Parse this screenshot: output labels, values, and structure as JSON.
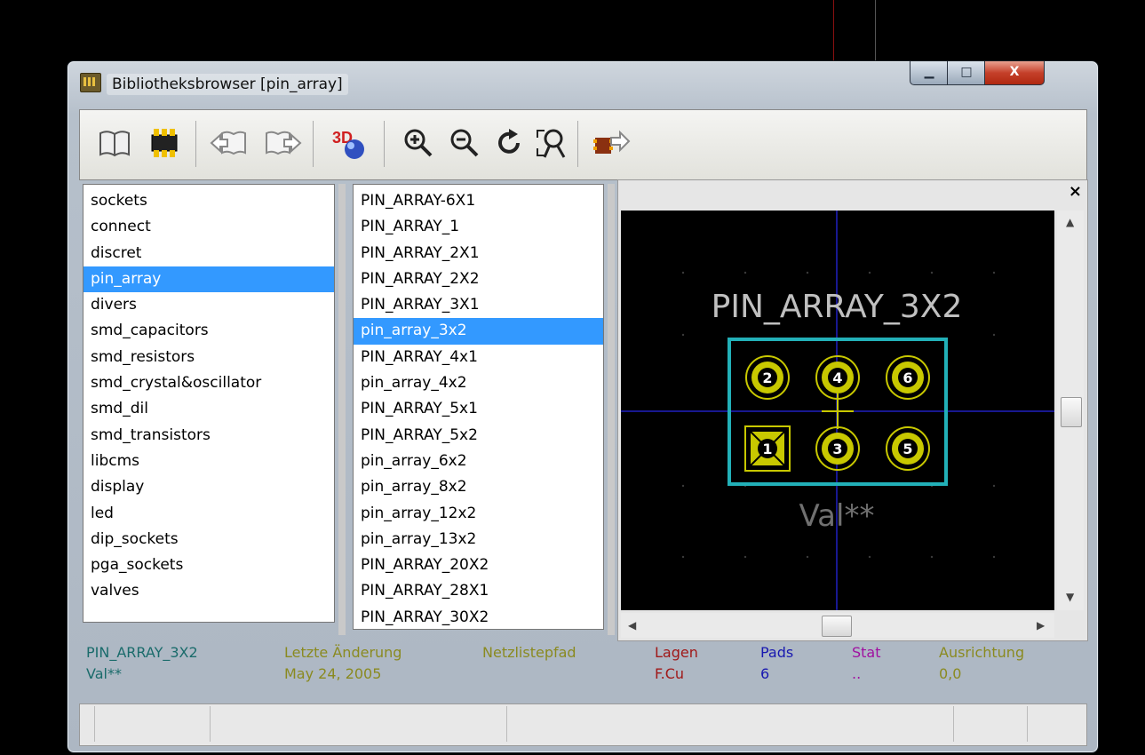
{
  "window": {
    "title": "Bibliotheksbrowser [pin_array]"
  },
  "window_controls": {
    "minimize": "▁",
    "maximize": "□",
    "close": "X"
  },
  "toolbar": [
    {
      "name": "select-library-icon",
      "glyph": "📖"
    },
    {
      "name": "select-footprint-icon",
      "glyph": "▦"
    },
    {
      "name": "previous-footprint-icon",
      "glyph": "⇦"
    },
    {
      "name": "next-footprint-icon",
      "glyph": "⇨"
    },
    {
      "name": "3d-view-icon",
      "glyph": "3D"
    },
    {
      "name": "zoom-in-icon",
      "glyph": "⊕"
    },
    {
      "name": "zoom-out-icon",
      "glyph": "⊖"
    },
    {
      "name": "redraw-icon",
      "glyph": "↻"
    },
    {
      "name": "zoom-fit-icon",
      "glyph": "⌕"
    },
    {
      "name": "export-footprint-icon",
      "glyph": "➦"
    }
  ],
  "libraries": {
    "items": [
      "sockets",
      "connect",
      "discret",
      "pin_array",
      "divers",
      "smd_capacitors",
      "smd_resistors",
      "smd_crystal&oscillator",
      "smd_dil",
      "smd_transistors",
      "libcms",
      "display",
      "led",
      "dip_sockets",
      "pga_sockets",
      "valves"
    ],
    "selected": "pin_array"
  },
  "footprints": {
    "items": [
      "PIN_ARRAY-6X1",
      "PIN_ARRAY_1",
      "PIN_ARRAY_2X1",
      "PIN_ARRAY_2X2",
      "PIN_ARRAY_3X1",
      "pin_array_3x2",
      "PIN_ARRAY_4x1",
      "pin_array_4x2",
      "PIN_ARRAY_5x1",
      "PIN_ARRAY_5x2",
      "pin_array_6x2",
      "pin_array_8x2",
      "pin_array_12x2",
      "pin_array_13x2",
      "PIN_ARRAY_20X2",
      "PIN_ARRAY_28X1",
      "PIN_ARRAY_30X2"
    ],
    "selected": "pin_array_3x2"
  },
  "viewer": {
    "close": "×",
    "reference": "PIN_ARRAY_3X2",
    "value": "Val**",
    "pads": [
      "2",
      "4",
      "6",
      "1",
      "3",
      "5"
    ]
  },
  "status": {
    "name": "PIN_ARRAY_3X2",
    "value": "Val**",
    "last_change_label": "Letzte Änderung",
    "last_change_value": "May 24, 2005",
    "netlist_label": "Netzlistepfad",
    "netlist_value": "",
    "layers_label": "Lagen",
    "layers_value": "F.Cu",
    "pads_label": "Pads",
    "pads_value": "6",
    "stat_label": "Stat",
    "stat_value": "..",
    "orient_label": "Ausrichtung",
    "orient_value": "0,0"
  },
  "colors": {
    "selection": "#3399ff",
    "pad": "#c8c800",
    "outline": "#22b0b8",
    "text": "#c0c0c0",
    "axis": "#2020c0"
  }
}
